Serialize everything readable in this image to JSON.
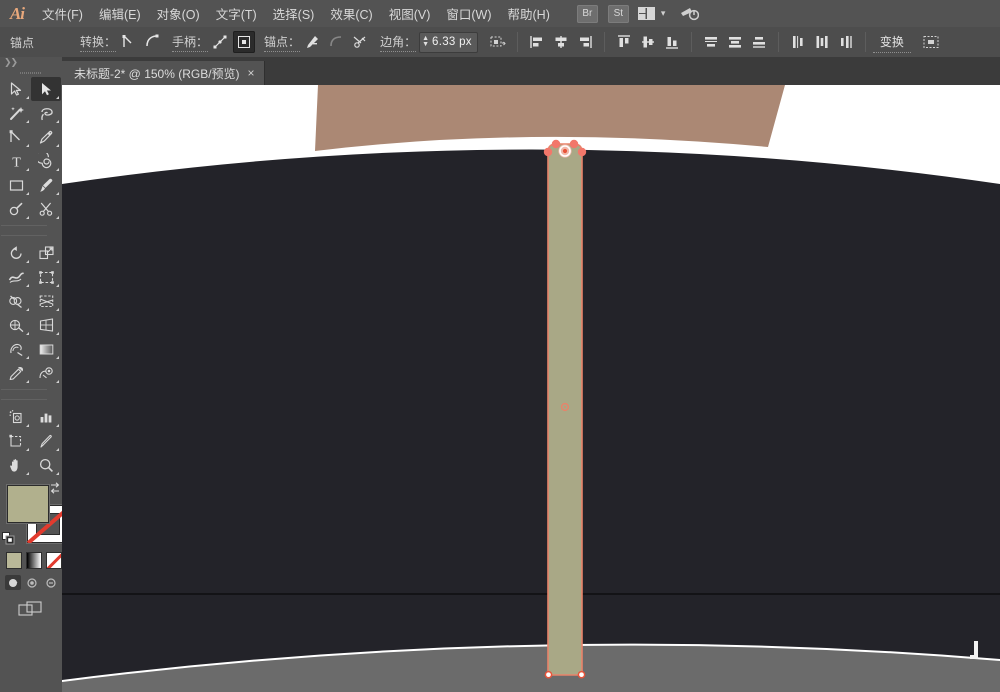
{
  "app": {
    "name": "Adobe Illustrator",
    "logo_text": "Ai"
  },
  "menubar": {
    "items": [
      {
        "label": "文件(F)",
        "name": "menu-file"
      },
      {
        "label": "编辑(E)",
        "name": "menu-edit"
      },
      {
        "label": "对象(O)",
        "name": "menu-object"
      },
      {
        "label": "文字(T)",
        "name": "menu-type"
      },
      {
        "label": "选择(S)",
        "name": "menu-select"
      },
      {
        "label": "效果(C)",
        "name": "menu-effect"
      },
      {
        "label": "视图(V)",
        "name": "menu-view"
      },
      {
        "label": "窗口(W)",
        "name": "menu-window"
      },
      {
        "label": "帮助(H)",
        "name": "menu-help"
      }
    ],
    "bridge_label": "Br",
    "stock_label": "St",
    "arrange_icon": "arrange-documents-icon",
    "caret_icon": "chevron-down-icon",
    "workspace_icon": "workspace-switcher-icon"
  },
  "controlbar": {
    "selection_label": "锚点",
    "convert_label": "转换：",
    "handle_label": "手柄：",
    "anchor_label": "锚点：",
    "corner_label": "边角：",
    "corner_value": "6.33 px",
    "transform_label": "变换",
    "icons": {
      "convert_to_corner": "convert-to-corner-icon",
      "convert_to_smooth": "convert-to-smooth-icon",
      "show_handles": "show-handles-icon",
      "hide_handles": "hide-handles-icon",
      "remove_anchor": "remove-anchor-icon",
      "connect_anchor": "connect-anchor-icon",
      "cut_path": "cut-path-icon",
      "isolate": "isolate-selected-icon",
      "align_left": "align-left-icon",
      "align_center_h": "align-center-horizontal-icon",
      "align_right": "align-right-icon",
      "align_top": "align-top-icon",
      "align_center_v": "align-center-vertical-icon",
      "align_bottom": "align-bottom-icon",
      "dist_top": "distribute-top-icon",
      "dist_center_v": "distribute-center-vertical-icon",
      "dist_bottom": "distribute-bottom-icon",
      "dist_left": "distribute-left-icon",
      "dist_center_h": "distribute-center-horizontal-icon",
      "dist_right": "distribute-right-icon",
      "align_panel": "align-options-icon"
    }
  },
  "document_tab": {
    "label": "未标题-2* @ 150% (RGB/预览)",
    "close_label": "×",
    "title": "未标题-2",
    "modified": "*",
    "zoom": "150%",
    "color_mode": "RGB",
    "view_mode": "预览"
  },
  "toolbar": {
    "grip_label": "",
    "tools": [
      {
        "name": "tool-selection",
        "icon": "selection-arrow-icon",
        "selected": false
      },
      {
        "name": "tool-direct-selection",
        "icon": "direct-selection-arrow-icon",
        "selected": true
      },
      {
        "name": "tool-magic-wand",
        "icon": "magic-wand-icon",
        "selected": false
      },
      {
        "name": "tool-lasso",
        "icon": "lasso-icon",
        "selected": false
      },
      {
        "name": "tool-pen",
        "icon": "pen-icon",
        "selected": false
      },
      {
        "name": "tool-curvature",
        "icon": "curvature-icon",
        "selected": false
      },
      {
        "name": "tool-type",
        "icon": "type-t-icon",
        "selected": false
      },
      {
        "name": "tool-line-segment",
        "icon": "spiral-icon",
        "selected": false
      },
      {
        "name": "tool-rectangle",
        "icon": "rectangle-icon",
        "selected": false
      },
      {
        "name": "tool-paintbrush",
        "icon": "paintbrush-icon",
        "selected": false
      },
      {
        "name": "tool-shaper",
        "icon": "shaper-pencil-icon",
        "selected": false
      },
      {
        "name": "tool-scissors",
        "icon": "scissors-icon",
        "selected": false
      },
      {
        "name": "tool-rotate",
        "icon": "rotate-icon",
        "selected": false
      },
      {
        "name": "tool-scale",
        "icon": "scale-icon",
        "selected": false
      },
      {
        "name": "tool-width",
        "icon": "width-warp-icon",
        "selected": false
      },
      {
        "name": "tool-free-transform",
        "icon": "free-transform-icon",
        "selected": false
      },
      {
        "name": "tool-shape-builder",
        "icon": "shape-builder-icon",
        "selected": false
      },
      {
        "name": "tool-perspective-grid",
        "icon": "perspective-grid-icon",
        "selected": false
      },
      {
        "name": "tool-mesh",
        "icon": "mesh-icon",
        "selected": false
      },
      {
        "name": "tool-gradient",
        "icon": "gradient-icon",
        "selected": false
      },
      {
        "name": "tool-eyedropper",
        "icon": "eyedropper-icon",
        "selected": false
      },
      {
        "name": "tool-blend",
        "icon": "blend-icon",
        "selected": false
      },
      {
        "name": "tool-symbol-sprayer",
        "icon": "symbol-sprayer-icon",
        "selected": false
      },
      {
        "name": "tool-column-graph",
        "icon": "bar-graph-icon",
        "selected": false
      },
      {
        "name": "tool-artboard",
        "icon": "artboard-icon",
        "selected": false
      },
      {
        "name": "tool-slice",
        "icon": "slice-knife-icon",
        "selected": false
      },
      {
        "name": "tool-hand",
        "icon": "hand-icon",
        "selected": false
      },
      {
        "name": "tool-zoom",
        "icon": "magnifier-icon",
        "selected": false
      }
    ],
    "fill_color": "#b1b08d",
    "stroke_color": "#ffffff",
    "stroke_none": true,
    "swap_icon": "swap-fill-stroke-icon",
    "revert_icon": "default-fill-stroke-icon",
    "color_modes": [
      {
        "name": "mode-color",
        "icon": "flat-color-icon"
      },
      {
        "name": "mode-gradient",
        "icon": "gradient-swatch-icon"
      },
      {
        "name": "mode-none",
        "icon": "none-swatch-icon"
      }
    ],
    "draw_modes": [
      {
        "name": "draw-normal",
        "icon": "draw-normal-icon",
        "active": true
      },
      {
        "name": "draw-behind",
        "icon": "draw-behind-icon",
        "active": false
      },
      {
        "name": "draw-inside",
        "icon": "draw-inside-icon",
        "active": false
      }
    ],
    "screen_mode": {
      "name": "screen-mode",
      "icon": "change-screen-mode-icon"
    }
  },
  "canvas": {
    "background": "#ffffff",
    "shapes": {
      "dark_mass_color": "#232329",
      "tan_shape_color": "#ab8874",
      "gray_band_color": "#6b6b6b",
      "selected_rect_fill": "#a9a886",
      "selected_rect_stroke": "#e8836a"
    },
    "selection": {
      "anchor_color": "#f2776a",
      "anchor_fill": "#ffffff",
      "widget_label": "corner-radius-widget",
      "corner_radius_px": "6.33"
    }
  }
}
